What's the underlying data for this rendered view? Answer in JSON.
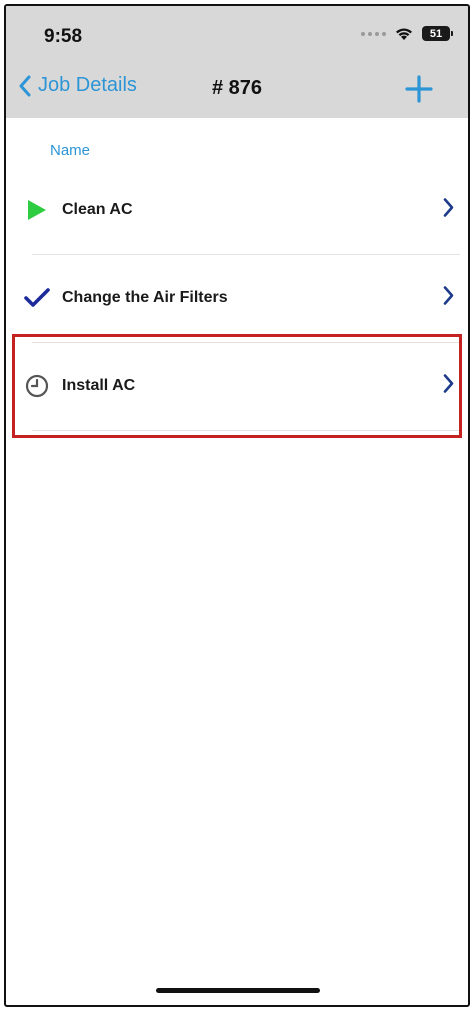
{
  "status_bar": {
    "time": "9:58",
    "battery": "51"
  },
  "nav": {
    "back_label": "Job Details",
    "title": "# 876",
    "add_icon": "plus-icon",
    "back_icon": "chevron-left-icon"
  },
  "list": {
    "section_header": "Name",
    "items": [
      {
        "label": "Clean AC",
        "status_icon": "play-icon",
        "status_color": "#2ecc40"
      },
      {
        "label": "Change the Air Filters",
        "status_icon": "checkmark-icon",
        "status_color": "#1d2b9a"
      },
      {
        "label": "Install AC",
        "status_icon": "clock-icon",
        "status_color": "#555555"
      }
    ]
  },
  "colors": {
    "accent": "#2c95d6",
    "chevron": "#1e3a8a",
    "highlight": "#c42121"
  }
}
